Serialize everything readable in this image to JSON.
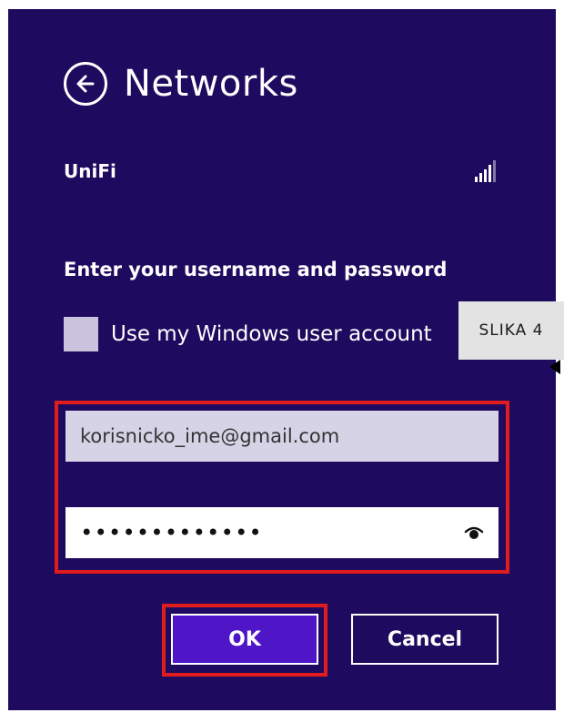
{
  "header": {
    "title": "Networks",
    "back_icon": "back-arrow-icon"
  },
  "network": {
    "name": "UniFi",
    "signal_icon": "wifi-signal-icon"
  },
  "auth": {
    "prompt": "Enter your username and password",
    "use_windows_account_label": "Use my Windows user account",
    "use_windows_account_checked": false,
    "username_value": "korisnicko_ime@gmail.com",
    "password_masked": "•••••••••••••",
    "reveal_icon": "eye-icon"
  },
  "buttons": {
    "ok_label": "OK",
    "cancel_label": "Cancel"
  },
  "badge": {
    "label": "SLIKA 4"
  },
  "colors": {
    "panel_bg": "#1e0a5e",
    "ok_button_bg": "#4f16c8",
    "highlight_border": "#e01c1c",
    "username_field_bg": "#d7d3e6"
  }
}
